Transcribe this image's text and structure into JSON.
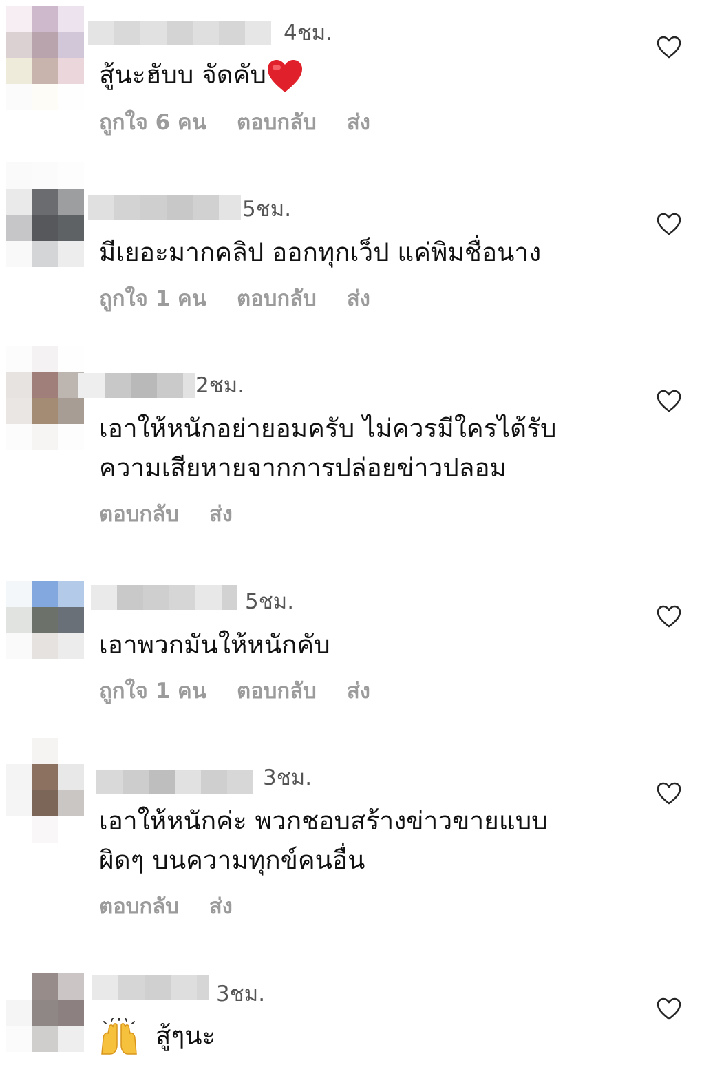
{
  "comments": [
    {
      "time": "4ชม.",
      "text": "สู้นะฮับบ จัดคับ",
      "emoji": "heart-emoji",
      "likes": "ถูกใจ 6 คน",
      "reply": "ตอบกลับ",
      "send": "ส่ง"
    },
    {
      "time": "5ชม.",
      "text": "มีเยอะมากคลิป  ออกทุกเว็ป แค่พิมชื่อนาง",
      "likes": "ถูกใจ 1 คน",
      "reply": "ตอบกลับ",
      "send": "ส่ง"
    },
    {
      "time": "2ชม.",
      "text": "เอาให้หนักอย่ายอมครับ ไม่ควรมีใครได้รับ",
      "text2": "ความเสียหายจากการปล่อยข่าวปลอม",
      "reply": "ตอบกลับ",
      "send": "ส่ง"
    },
    {
      "time": "5ชม.",
      "text": "เอาพวกมันให้หนักคับ",
      "likes": "ถูกใจ 1 คน",
      "reply": "ตอบกลับ",
      "send": "ส่ง"
    },
    {
      "time": "3ชม.",
      "text": "เอาให้หนักค่ะ พวกชอบสร้างข่าวขายแบบ",
      "text2": "ผิดๆ บนความทุกข์คนอื่น",
      "reply": "ตอบกลับ",
      "send": "ส่ง"
    },
    {
      "time": "3ชม.",
      "emoji": "raising-hands-emoji",
      "text": "สู้ๆนะ"
    }
  ],
  "icons": {
    "like": "heart-outline-icon"
  },
  "colors": {
    "text": "#111111",
    "meta": "#9b9b9b",
    "time": "#555555"
  }
}
